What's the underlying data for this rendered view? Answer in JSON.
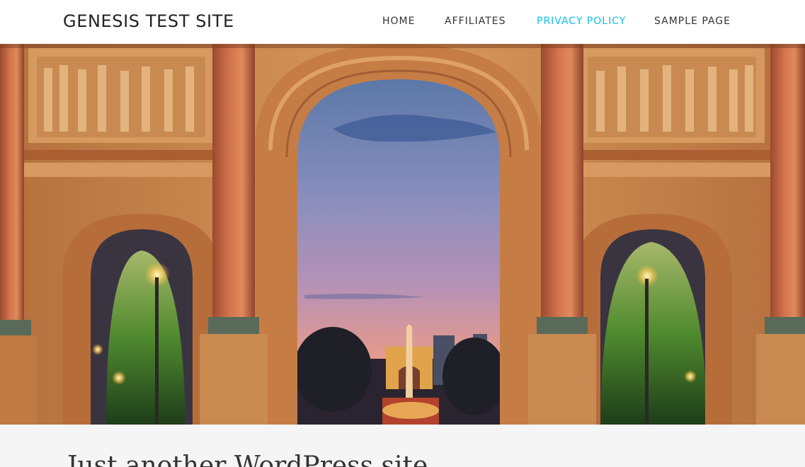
{
  "header": {
    "site_title": "GENESIS TEST SITE"
  },
  "nav": {
    "items": [
      {
        "label": "HOME",
        "active": false
      },
      {
        "label": "AFFILIATES",
        "active": false
      },
      {
        "label": "PRIVACY POLICY",
        "active": true
      },
      {
        "label": "SAMPLE PAGE",
        "active": false
      }
    ]
  },
  "hero": {
    "image": "arc-de-triomphe-du-carrousel-dusk-photo"
  },
  "content": {
    "tagline": "Just another WordPress site"
  },
  "colors": {
    "accent": "#0ebfe9",
    "text": "#333333",
    "background": "#f5f5f5"
  }
}
